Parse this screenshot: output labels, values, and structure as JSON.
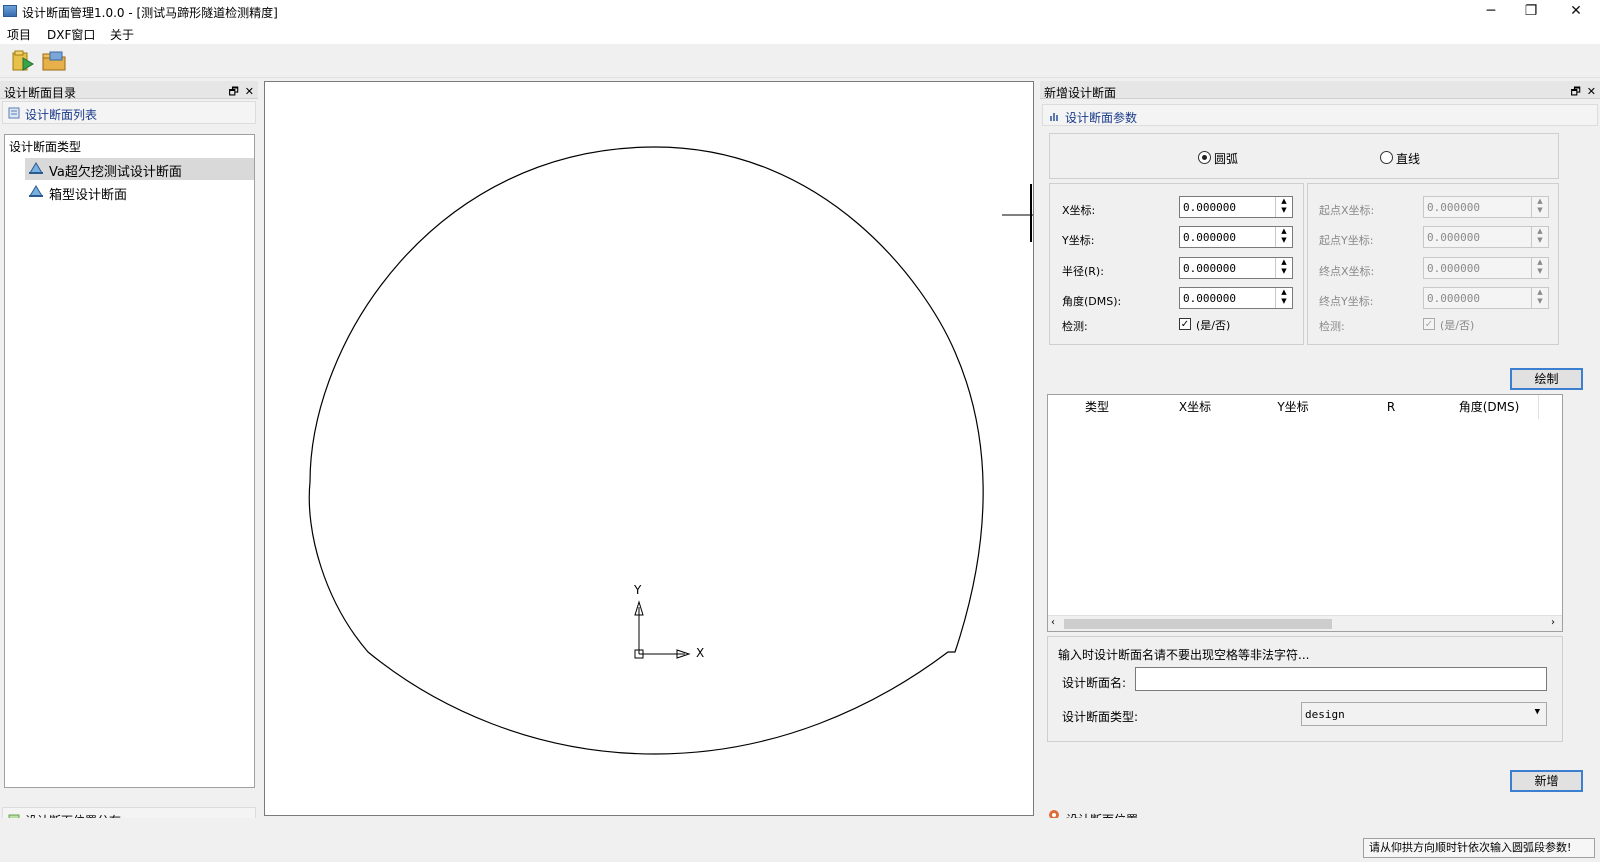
{
  "window": {
    "title": "设计断面管理1.0.0 - [测试马蹄形隧道检测精度]",
    "minimize": "─",
    "restore": "❐",
    "close": "✕"
  },
  "menu": [
    "项目",
    "DXF窗口",
    "关于"
  ],
  "left_panel": {
    "title": "设计断面目录",
    "list_section": "设计断面列表",
    "tree_root": "设计断面类型",
    "tree_items": [
      "Va超欠挖测试设计断面",
      "箱型设计断面"
    ],
    "bottom_section": "设计断面位置分布"
  },
  "canvas": {
    "axis_y": "Y",
    "axis_x": "X"
  },
  "right_panel": {
    "title": "新增设计断面",
    "params_section": "设计断面参数",
    "radio_arc": "圆弧",
    "radio_line": "直线",
    "arc_fields": [
      {
        "label": "X坐标:",
        "value": "0.000000"
      },
      {
        "label": "Y坐标:",
        "value": "0.000000"
      },
      {
        "label": "半径(R):",
        "value": "0.000000"
      },
      {
        "label": "角度(DMS):",
        "value": "0.000000"
      }
    ],
    "arc_check_label": "检测:",
    "arc_check_text": "(是/否)",
    "line_fields": [
      {
        "label": "起点X坐标:",
        "value": "0.000000"
      },
      {
        "label": "起点Y坐标:",
        "value": "0.000000"
      },
      {
        "label": "终点X坐标:",
        "value": "0.000000"
      },
      {
        "label": "终点Y坐标:",
        "value": "0.000000"
      }
    ],
    "line_check_label": "检测:",
    "line_check_text": "(是/否)",
    "draw_button": "绘制",
    "grid_columns": [
      "类型",
      "X坐标",
      "Y坐标",
      "R",
      "角度(DMS)"
    ],
    "hint": "输入时设计断面名请不要出现空格等非法字符...",
    "name_label": "设计断面名:",
    "name_value": "",
    "type_label": "设计断面类型:",
    "type_value": "design",
    "add_button": "新增",
    "location_section": "设计断面位置"
  },
  "status": {
    "message": "请从仰拱方向顺时针依次输入圆弧段参数!"
  }
}
